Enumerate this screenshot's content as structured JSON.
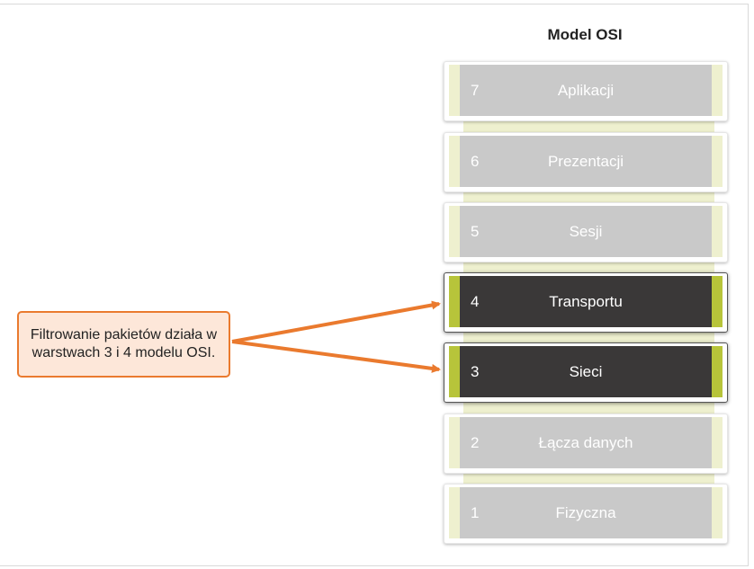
{
  "diagram": {
    "title": "Model OSI",
    "layers": [
      {
        "number": "7",
        "name": "Aplikacji",
        "highlighted": false
      },
      {
        "number": "6",
        "name": "Prezentacji",
        "highlighted": false
      },
      {
        "number": "5",
        "name": "Sesji",
        "highlighted": false
      },
      {
        "number": "4",
        "name": "Transportu",
        "highlighted": true
      },
      {
        "number": "3",
        "name": "Sieci",
        "highlighted": true
      },
      {
        "number": "2",
        "name": "Łącza danych",
        "highlighted": false
      },
      {
        "number": "1",
        "name": "Fizyczna",
        "highlighted": false
      }
    ],
    "callout": {
      "text": "Filtrowanie pakietów działa w warstwach 3 i 4 modelu OSI."
    },
    "colors": {
      "inactive_layer": "#c9c9c9",
      "active_layer": "#3a3838",
      "accent_bar_active": "#b7c43a",
      "accent_bar_inactive": "#eef0cf",
      "callout_border": "#ea7a2e",
      "callout_fill": "#fde7d9",
      "arrow": "#ea7a2e"
    }
  }
}
